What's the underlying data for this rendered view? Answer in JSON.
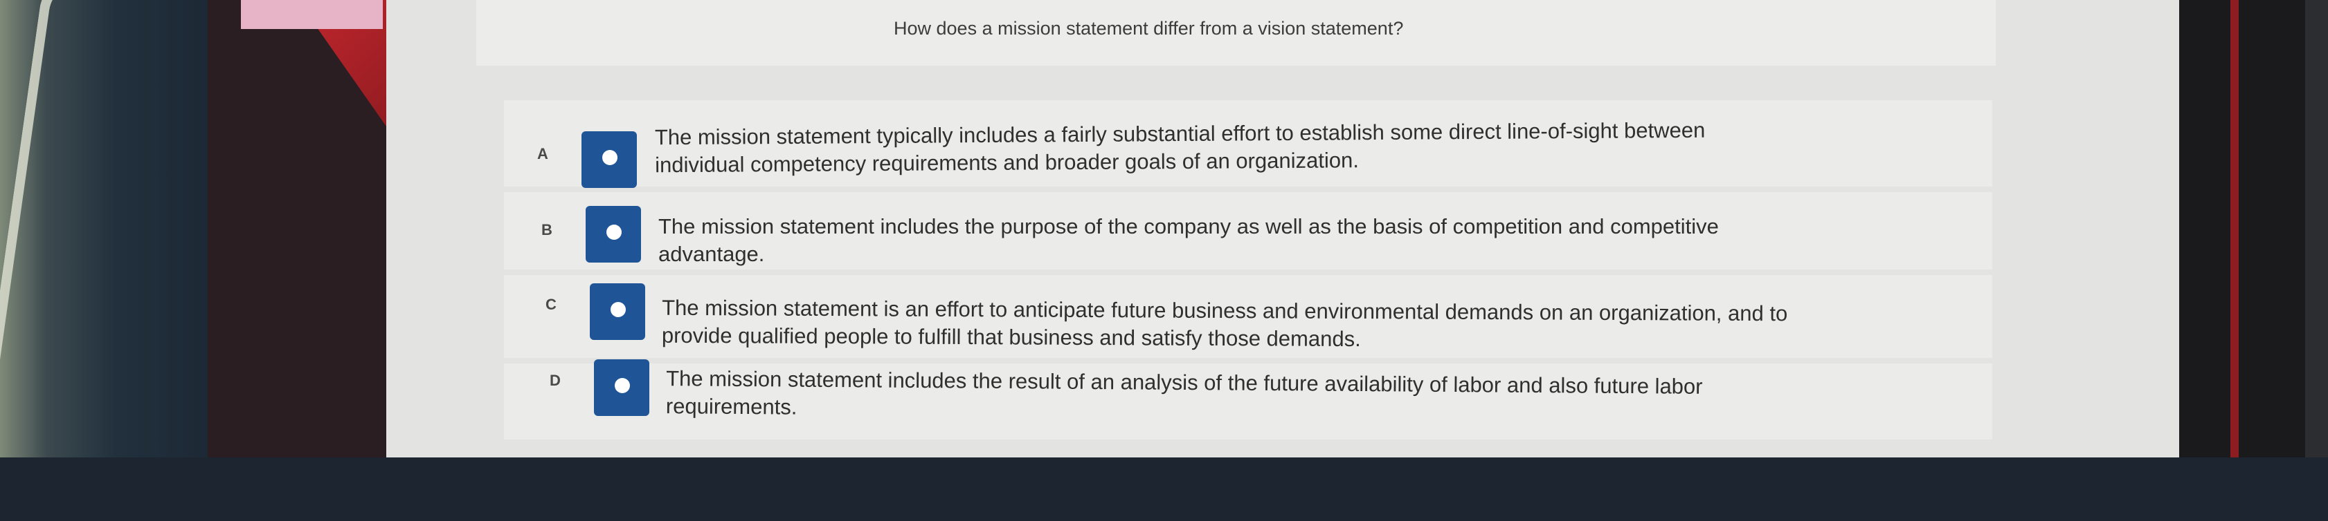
{
  "question": "How does a mission statement differ from a vision statement?",
  "options": [
    {
      "letter": "A",
      "line1": "The mission statement typically includes a fairly substantial effort to establish some direct line-of-sight between",
      "line2": "individual competency requirements and broader goals of an organization."
    },
    {
      "letter": "B",
      "line1": "The mission statement includes the purpose of the company as well as the basis of competition and competitive",
      "line2": "advantage."
    },
    {
      "letter": "C",
      "line1": "The mission statement is an effort to anticipate future business and environmental demands on an organization, and to",
      "line2": "provide qualified people to fulfill that business and satisfy those demands."
    },
    {
      "letter": "D",
      "line1": "The mission statement includes the result of an analysis of the future availability of labor and also future labor",
      "line2": "requirements."
    }
  ],
  "colors": {
    "radio": "#1f5597",
    "page": "#e3e3e1",
    "card": "#ebebea"
  }
}
